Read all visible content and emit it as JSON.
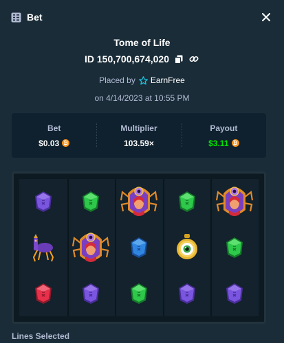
{
  "header": {
    "title": "Bet",
    "icon": "bet-slip-icon",
    "close_icon": "close-icon"
  },
  "game": {
    "title": "Tome of Life"
  },
  "bet": {
    "id": "ID 150,700,674,020",
    "copy_icon": "copy-icon",
    "link_icon": "link-icon"
  },
  "placed": {
    "prefix": "Placed by",
    "user": "EarnFree",
    "user_icon": "star-badge-icon"
  },
  "date": "on 4/14/2023 at 10:55 PM",
  "stats": {
    "bet_label": "Bet",
    "bet_value": "$0.03",
    "multiplier_label": "Multiplier",
    "multiplier_value": "103.59×",
    "payout_label": "Payout",
    "payout_value": "$3.11",
    "currency_icon": "bitcoin-coin-icon",
    "currency_symbol": "₿"
  },
  "reels": {
    "grid": [
      [
        "purple-gem",
        "green-gem",
        "spider-priestess",
        "green-gem",
        "spider-priestess"
      ],
      [
        "purple-spider-beast",
        "spider-priestess",
        "blue-gem",
        "golden-eye-amulet",
        "green-gem"
      ],
      [
        "red-gem",
        "purple-gem",
        "green-gem",
        "purple-gem",
        "purple-gem"
      ]
    ]
  },
  "footer": {
    "lines_selected_label": "Lines Selected"
  },
  "colors": {
    "background": "#1a2c38",
    "panel": "#0f212e",
    "muted_text": "#b1bad3",
    "payout_green": "#00e701",
    "coin_orange": "#f7931a"
  }
}
